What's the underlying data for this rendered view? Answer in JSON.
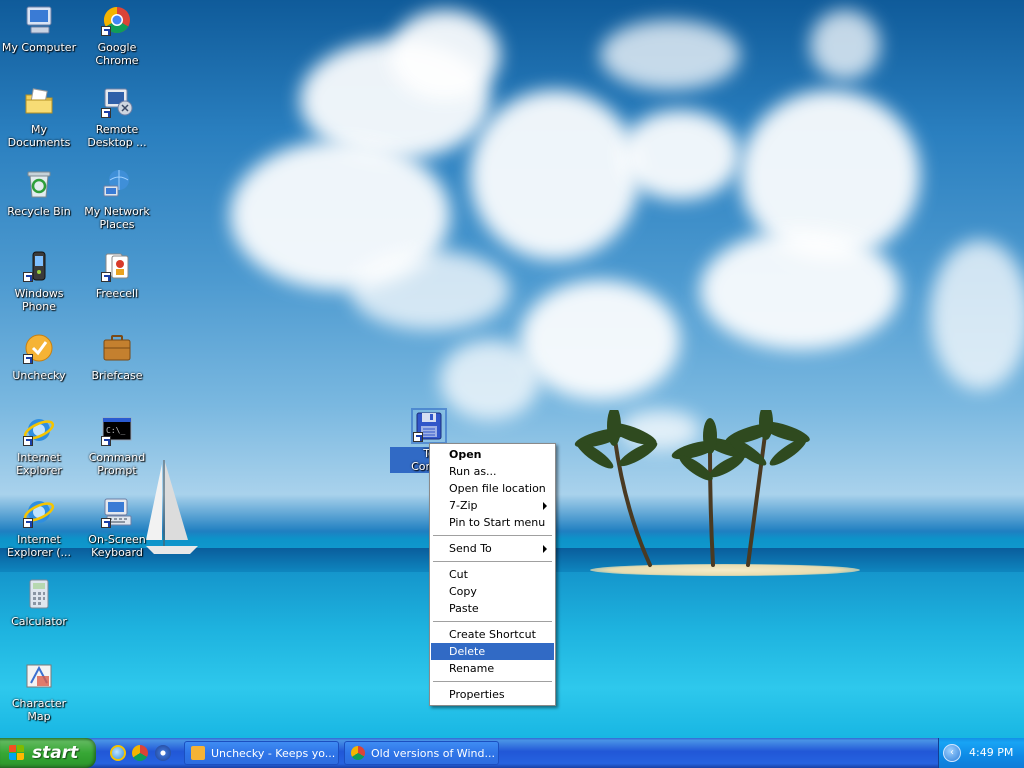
{
  "desktop": {
    "icons": [
      {
        "name": "my-computer",
        "label": "My Computer",
        "icon": "computer-icon"
      },
      {
        "name": "google-chrome",
        "label": "Google Chrome",
        "icon": "chrome-icon"
      },
      {
        "name": "my-documents",
        "label": "My Documents",
        "icon": "folder-icon"
      },
      {
        "name": "remote-desktop",
        "label": "Remote Desktop ...",
        "icon": "remote-desktop-icon"
      },
      {
        "name": "recycle-bin",
        "label": "Recycle Bin",
        "icon": "recycle-bin-icon"
      },
      {
        "name": "my-network-places",
        "label": "My Network Places",
        "icon": "network-icon"
      },
      {
        "name": "windows-phone",
        "label": "Windows Phone",
        "icon": "phone-icon"
      },
      {
        "name": "freecell",
        "label": "Freecell",
        "icon": "cards-icon"
      },
      {
        "name": "unchecky",
        "label": "Unchecky",
        "icon": "unchecky-icon"
      },
      {
        "name": "briefcase",
        "label": "Briefcase",
        "icon": "briefcase-icon"
      },
      {
        "name": "internet-explorer",
        "label": "Internet Explorer",
        "icon": "ie-icon"
      },
      {
        "name": "command-prompt",
        "label": "Command Prompt",
        "icon": "cmd-icon"
      },
      {
        "name": "internet-explorer-2",
        "label": "Internet Explorer (...",
        "icon": "ie-icon"
      },
      {
        "name": "on-screen-keyboard",
        "label": "On-Screen Keyboard",
        "icon": "keyboard-icon"
      },
      {
        "name": "calculator",
        "label": "Calculator",
        "icon": "calculator-icon"
      },
      {
        "name": "character-map",
        "label": "Character Map",
        "icon": "charmap-icon"
      }
    ],
    "selected_icon": {
      "label_line1": "To",
      "label_line2": "Comm",
      "icon": "floppy-disk-icon"
    }
  },
  "context_menu": {
    "items": [
      {
        "label": "Open",
        "bold": true
      },
      {
        "label": "Run as..."
      },
      {
        "label": "Open file location"
      },
      {
        "label": "7-Zip",
        "submenu": true
      },
      {
        "label": "Pin to Start menu"
      },
      {
        "separator": true
      },
      {
        "label": "Send To",
        "submenu": true
      },
      {
        "separator": true
      },
      {
        "label": "Cut"
      },
      {
        "label": "Copy"
      },
      {
        "label": "Paste"
      },
      {
        "separator": true
      },
      {
        "label": "Create Shortcut"
      },
      {
        "label": "Delete",
        "highlighted": true
      },
      {
        "label": "Rename"
      },
      {
        "separator": true
      },
      {
        "label": "Properties"
      }
    ],
    "highlight_color": "#316ac5"
  },
  "taskbar": {
    "start_label": "start",
    "quick_launch": [
      "internet-explorer-icon",
      "chrome-icon",
      "media-player-icon"
    ],
    "tasks": [
      {
        "label": "Unchecky - Keeps yo...",
        "icon": "unchecky-icon"
      },
      {
        "label": "Old versions of Wind...",
        "icon": "chrome-icon"
      }
    ],
    "clock": "4:49 PM"
  }
}
